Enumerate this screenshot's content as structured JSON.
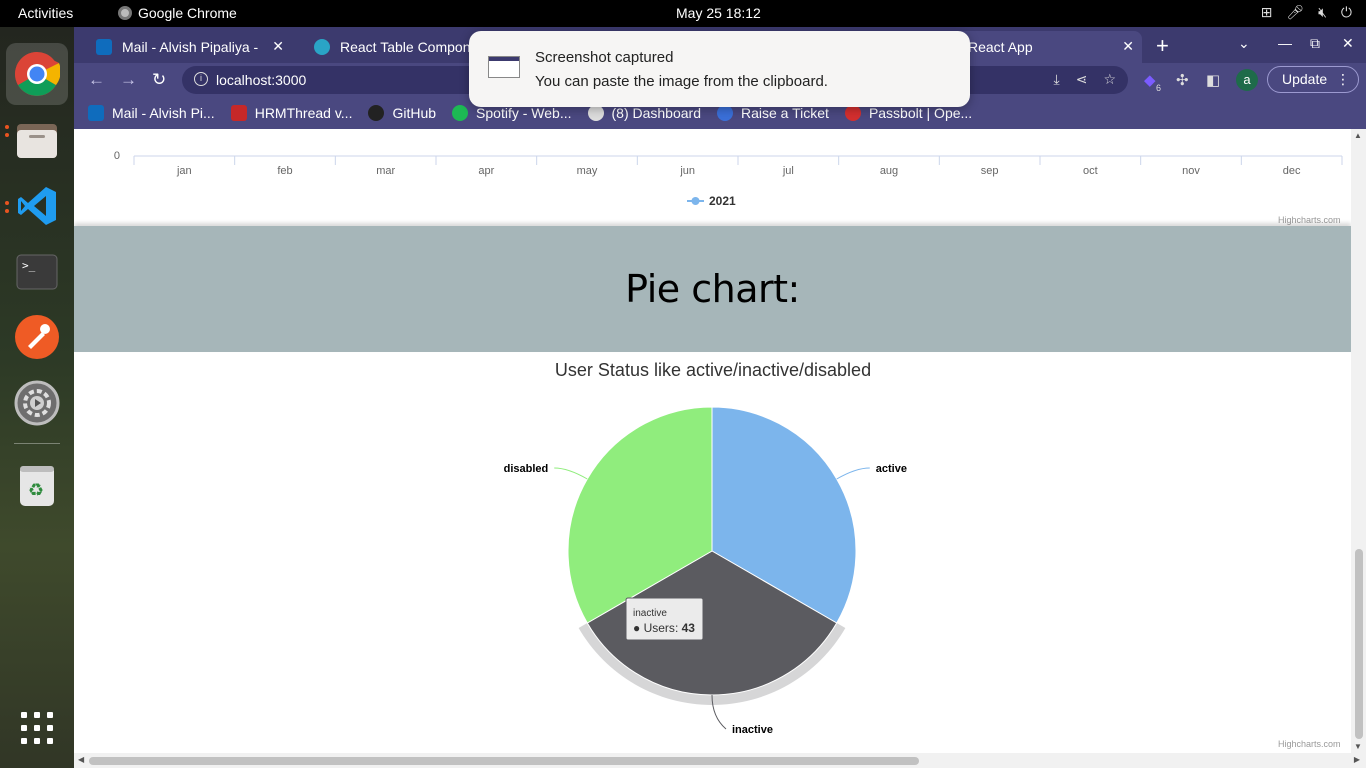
{
  "topbar": {
    "activities": "Activities",
    "app_name": "Google Chrome",
    "clock": "May 25  18:12",
    "tray_icons": [
      "network-icon",
      "mute-icon",
      "volume-icon",
      "power-icon"
    ]
  },
  "dock": {
    "items": [
      {
        "name": "chrome-icon",
        "color": "#4285f4"
      },
      {
        "name": "files-icon",
        "color": "#6b5a4a"
      },
      {
        "name": "vscode-icon",
        "color": "#0078d4"
      },
      {
        "name": "terminal-icon",
        "color": "#333333"
      },
      {
        "name": "postman-icon",
        "color": "#ef5b25"
      },
      {
        "name": "settings-icon",
        "color": "#888888"
      },
      {
        "name": "trash-icon",
        "color": "#e6e6e6"
      },
      {
        "name": "app-grid-icon",
        "color": "#ffffff"
      }
    ]
  },
  "tabs": [
    {
      "label": "Mail - Alvish Pipaliya -",
      "favicon": "outlook-icon",
      "color": "#0f6cbd",
      "close": "✕"
    },
    {
      "label": "React Table Compon",
      "favicon": "react-icon",
      "color": "#2aa4c6"
    },
    {
      "label": "React App",
      "favicon": "react-app-icon",
      "color": "#61dafb",
      "close": "✕"
    }
  ],
  "toolbar": {
    "url": "localhost:3000",
    "update_label": "Update",
    "profile_initial": "a",
    "extension_badge": "6"
  },
  "bookmarks": [
    {
      "label": "Mail - Alvish Pi...",
      "color": "#0f6cbd"
    },
    {
      "label": "HRMThread v...",
      "color": "#c62828"
    },
    {
      "label": "GitHub",
      "color": "#222222"
    },
    {
      "label": "Spotify - Web...",
      "color": "#1db954"
    },
    {
      "label": "(8) Dashboard",
      "color": "#dddddd"
    },
    {
      "label": "Raise a Ticket",
      "color": "#3a6fd8"
    },
    {
      "label": "Passbolt | Ope...",
      "color": "#d32f2f"
    }
  ],
  "notification": {
    "title": "Screenshot captured",
    "body": "You can paste the image from the clipboard."
  },
  "line_chart": {
    "y_zero_label": "0",
    "months": [
      "jan",
      "feb",
      "mar",
      "apr",
      "may",
      "jun",
      "jul",
      "aug",
      "sep",
      "oct",
      "nov",
      "dec"
    ],
    "legend": "2021",
    "series_color": "#7cb5ec",
    "credits": "Highcharts.com"
  },
  "section_heading": "Pie chart:",
  "chart_data": {
    "type": "pie",
    "title": "User Status like active/inactive/disabled",
    "slices": [
      {
        "name": "active",
        "value": 43,
        "color": "#7cb5ec"
      },
      {
        "name": "inactive",
        "value": 43,
        "color": "#5b5b60"
      },
      {
        "name": "disabled",
        "value": 43,
        "color": "#90ed7d"
      }
    ],
    "tooltip": {
      "category": "inactive",
      "series": "Users",
      "value": "43"
    },
    "credits": "Highcharts.com"
  }
}
